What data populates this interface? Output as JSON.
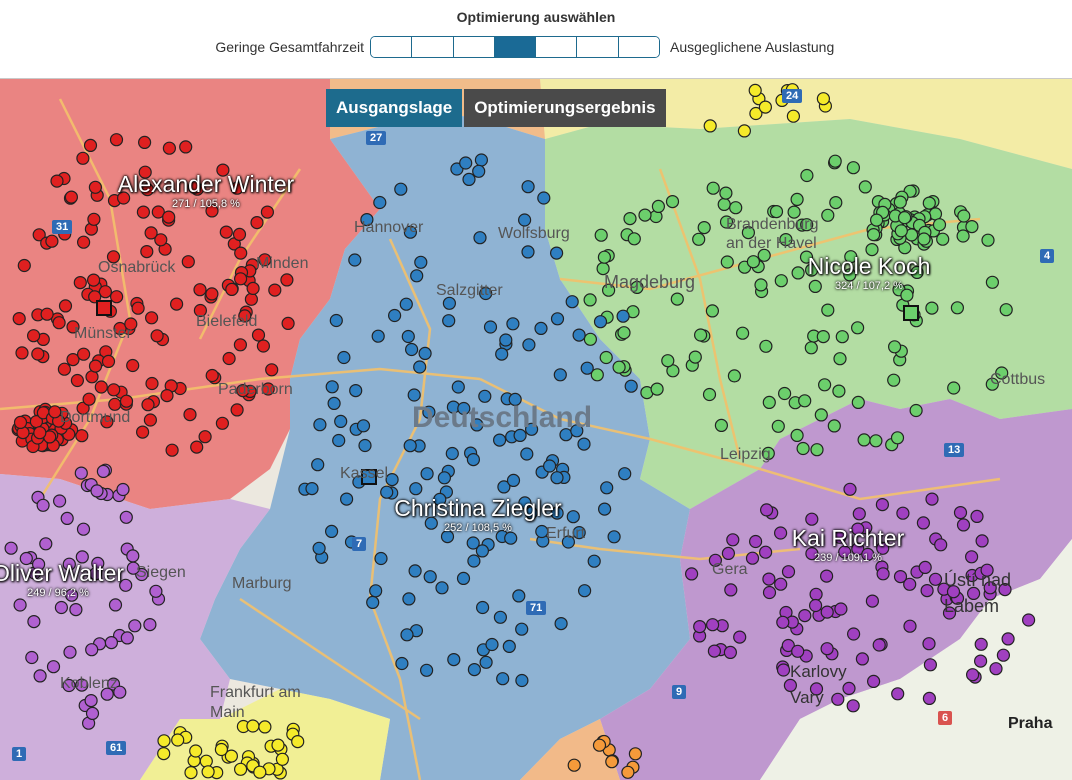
{
  "header": {
    "title": "Optimierung auswählen",
    "left_label": "Geringe Gesamtfahrzeit",
    "right_label": "Ausgeglichene Auslastung",
    "segments_total": 7,
    "active_segment": 4
  },
  "tabs": [
    {
      "label": "Ausgangslage",
      "active": true
    },
    {
      "label": "Optimierungsergebnis",
      "active": false
    }
  ],
  "map": {
    "center_label": "Deutschland",
    "places": [
      "Hannover",
      "Wolfsburg",
      "Salzgitter",
      "Magdeburg",
      "Brandenburg an der Havel",
      "Osnabrück",
      "Minden",
      "Bielefeld",
      "Münster",
      "Paderborn",
      "Dortmund",
      "Kassel",
      "Erfurt",
      "Marburg",
      "Siegen",
      "Koblenz",
      "Frankfurt am Main",
      "Cottbus",
      "Leipzig",
      "Ústí nad Labem",
      "Karlovy Vary",
      "Praha",
      "Gera"
    ],
    "road_shields": [
      "24",
      "27",
      "31",
      "7",
      "71",
      "13",
      "9",
      "6",
      "1",
      "61",
      "4"
    ]
  },
  "territories": [
    {
      "name": "Alexander Winter",
      "stats": "271 / 105,8 %",
      "color": "#e02020"
    },
    {
      "name": "Nicole Koch",
      "stats": "324 / 107,2 %",
      "color": "#6ccf6c"
    },
    {
      "name": "Christina Ziegler",
      "stats": "252 / 108,5 %",
      "color": "#2f7fc1"
    },
    {
      "name": "Kai Richter",
      "stats": "239 / 109,1 %",
      "color": "#a040c0"
    },
    {
      "name": "Oliver Walter",
      "stats": "249 / 96,2 %",
      "color": "#b060d0"
    }
  ]
}
